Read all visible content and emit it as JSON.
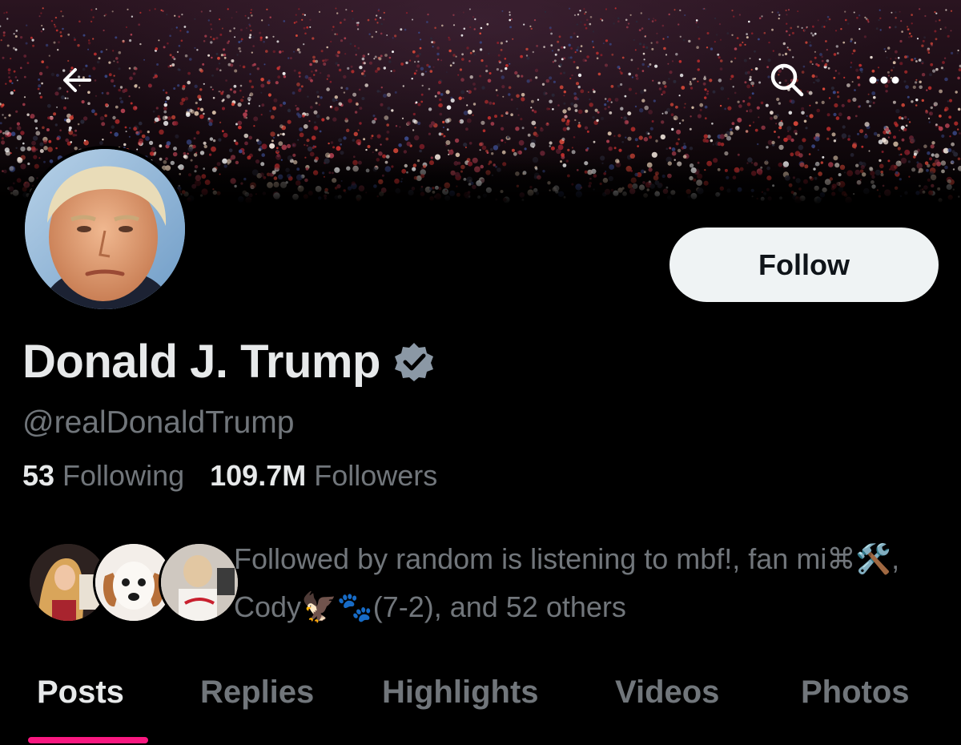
{
  "header": {
    "back_icon": "arrow-left-icon",
    "search_icon": "search-icon",
    "more_icon": "more-horizontal-icon"
  },
  "profile": {
    "display_name": "Donald J. Trump",
    "verified_icon": "verified-badge-icon",
    "verified_color": "#8b98a5",
    "handle": "@realDonaldTrump",
    "follow_label": "Follow",
    "following_count": "53",
    "following_label": "Following",
    "followers_count": "109.7M",
    "followers_label": "Followers"
  },
  "followed_by": {
    "text": "Followed by random is listening to mbf!, fan mi⌘🛠️, Cody🦅🐾(7-2), and 52 others"
  },
  "tabs": [
    {
      "label": "Posts",
      "active": true
    },
    {
      "label": "Replies",
      "active": false
    },
    {
      "label": "Highlights",
      "active": false
    },
    {
      "label": "Videos",
      "active": false
    },
    {
      "label": "Photos",
      "active": false
    }
  ],
  "colors": {
    "accent": "#f91880",
    "text_primary": "#e7e9ea",
    "text_secondary": "#71767b",
    "background": "#000000"
  }
}
